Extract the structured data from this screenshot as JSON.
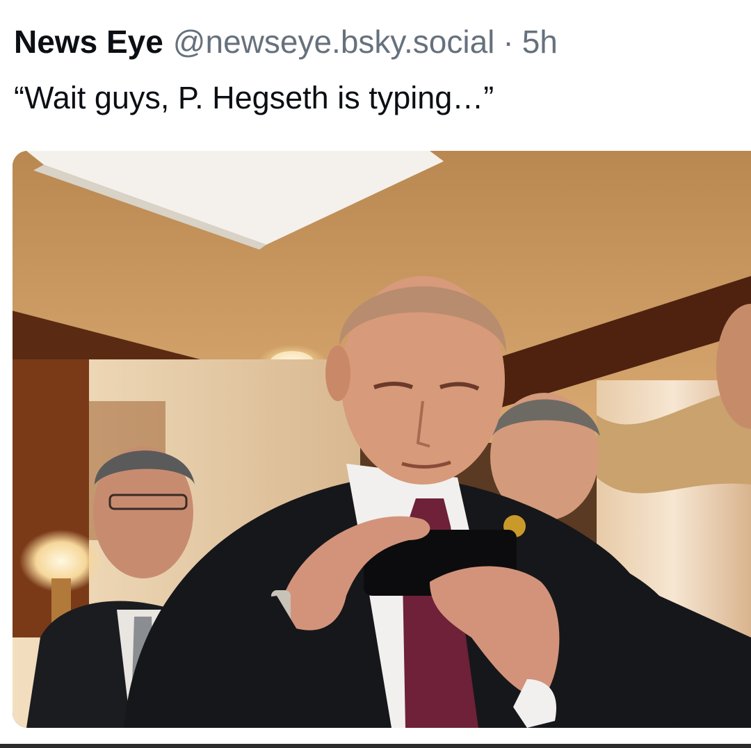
{
  "post": {
    "display_name": "News Eye",
    "handle": "@newseye.bsky.social",
    "separator": "·",
    "time": "5h",
    "text": "“Wait guys, P. Hegseth is typing…”"
  },
  "media": {
    "icon": "photo",
    "colors": {
      "ceiling": "#c9955c",
      "wood": "#5a2a12",
      "suit": "#15161a",
      "tie": "#6e2138",
      "skin": "#d79a7a",
      "curtain": "#d2b48c"
    }
  }
}
